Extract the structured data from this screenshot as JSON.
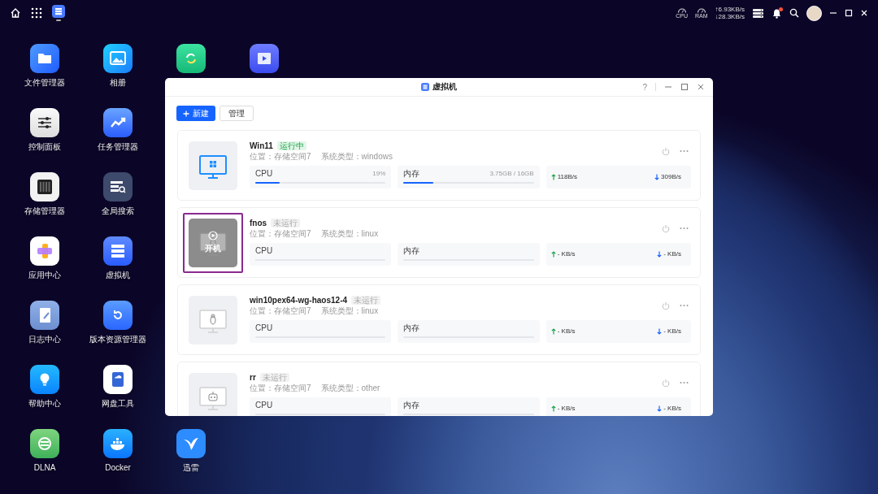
{
  "top_bar": {
    "monitors": [
      {
        "label": "CPU"
      },
      {
        "label": "RAM"
      }
    ],
    "upload": "↑6.93KB/s",
    "download": "↓28.3KB/s",
    "notification_dot": true
  },
  "desktop": {
    "columns": [
      [
        {
          "kind": "files",
          "label": "文件管理器"
        },
        {
          "kind": "control",
          "label": "控制面板"
        },
        {
          "kind": "storage",
          "label": "存储管理器"
        },
        {
          "kind": "apps",
          "label": "应用中心"
        },
        {
          "kind": "log",
          "label": "日志中心"
        },
        {
          "kind": "help",
          "label": "帮助中心"
        },
        {
          "kind": "dlna",
          "label": "DLNA"
        }
      ],
      [
        {
          "kind": "photos",
          "label": "相册"
        },
        {
          "kind": "tasks",
          "label": "任务管理器"
        },
        {
          "kind": "search",
          "label": "全局搜索"
        },
        {
          "kind": "vm",
          "label": "虚拟机"
        },
        {
          "kind": "versions",
          "label": "版本资源管理器"
        },
        {
          "kind": "cloud",
          "label": "网盘工具"
        },
        {
          "kind": "docker",
          "label": "Docker"
        }
      ],
      [
        {
          "kind": "sync"
        },
        {
          "kind": "thunder",
          "label": "迅雷"
        }
      ],
      [
        {
          "kind": "video"
        }
      ]
    ]
  },
  "window": {
    "title": "虚拟机",
    "help": "?",
    "toolbar": {
      "new_button": "新建",
      "manage_button": "管理"
    },
    "vms": [
      {
        "name": "Win11",
        "status": "运行中",
        "running": true,
        "highlighted": false,
        "kind": "windows",
        "location": "位置：存储空间7",
        "system_type": "系统类型：windows",
        "cpu": {
          "label": "CPU",
          "reading": "19%",
          "level": 0.19
        },
        "memory": {
          "label": "内存",
          "reading": "3.75GB / 16GB",
          "level": 0.23
        },
        "upload": "118B/s",
        "download": "309B/s"
      },
      {
        "name": "fnos",
        "status": "未运行",
        "running": false,
        "highlighted": true,
        "action_label": "开机",
        "kind": "linux",
        "location": "位置：存储空间7",
        "system_type": "系统类型：linux",
        "cpu": {
          "label": "CPU"
        },
        "memory": {
          "label": "内存"
        },
        "upload": "- KB/s",
        "download": "- KB/s"
      },
      {
        "name": "win10pex64-wg-haos12-4",
        "status": "未运行",
        "running": false,
        "highlighted": false,
        "kind": "linux",
        "location": "位置：存储空间7",
        "system_type": "系统类型：linux",
        "cpu": {
          "label": "CPU"
        },
        "memory": {
          "label": "内存"
        },
        "upload": "- KB/s",
        "download": "- KB/s"
      },
      {
        "name": "rr",
        "status": "未运行",
        "running": false,
        "highlighted": false,
        "kind": "other",
        "location": "位置：存储空间7",
        "system_type": "系统类型：other",
        "cpu": {
          "label": "CPU"
        },
        "memory": {
          "label": "内存"
        },
        "upload": "- KB/s",
        "download": "- KB/s"
      }
    ]
  }
}
